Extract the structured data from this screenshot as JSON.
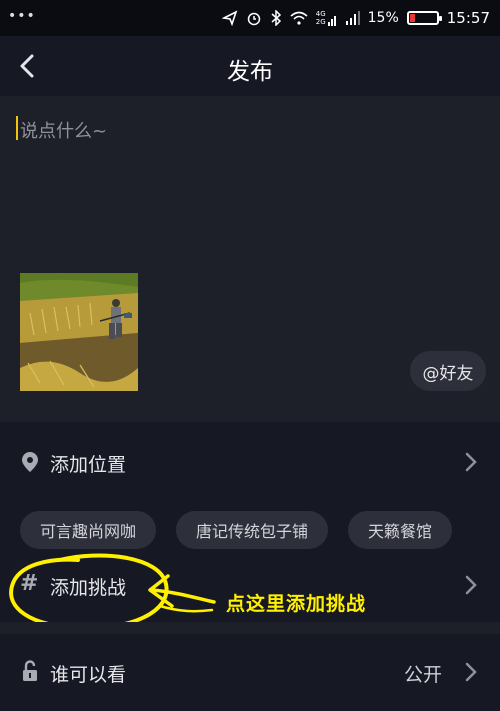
{
  "status_bar": {
    "dots": "•••",
    "battery": "15%",
    "time": "15:57",
    "network": [
      "4G",
      "2G"
    ]
  },
  "header": {
    "title": "发布"
  },
  "compose": {
    "placeholder": "说点什么~",
    "friend_button": "@好友"
  },
  "location": {
    "label": "添加位置",
    "suggestions": [
      "可言趣尚网咖",
      "唐记传统包子铺",
      "天籁餐馆"
    ]
  },
  "challenge": {
    "label": "添加挑战"
  },
  "annotation": {
    "text": "点这里添加挑战"
  },
  "visibility": {
    "label": "谁可以看",
    "value": "公开"
  },
  "colors": {
    "background": "#161823",
    "panel": "#1e2029",
    "accent_caret": "#f1c40f",
    "annotation": "#ffef00",
    "battery_low": "#e53935"
  }
}
